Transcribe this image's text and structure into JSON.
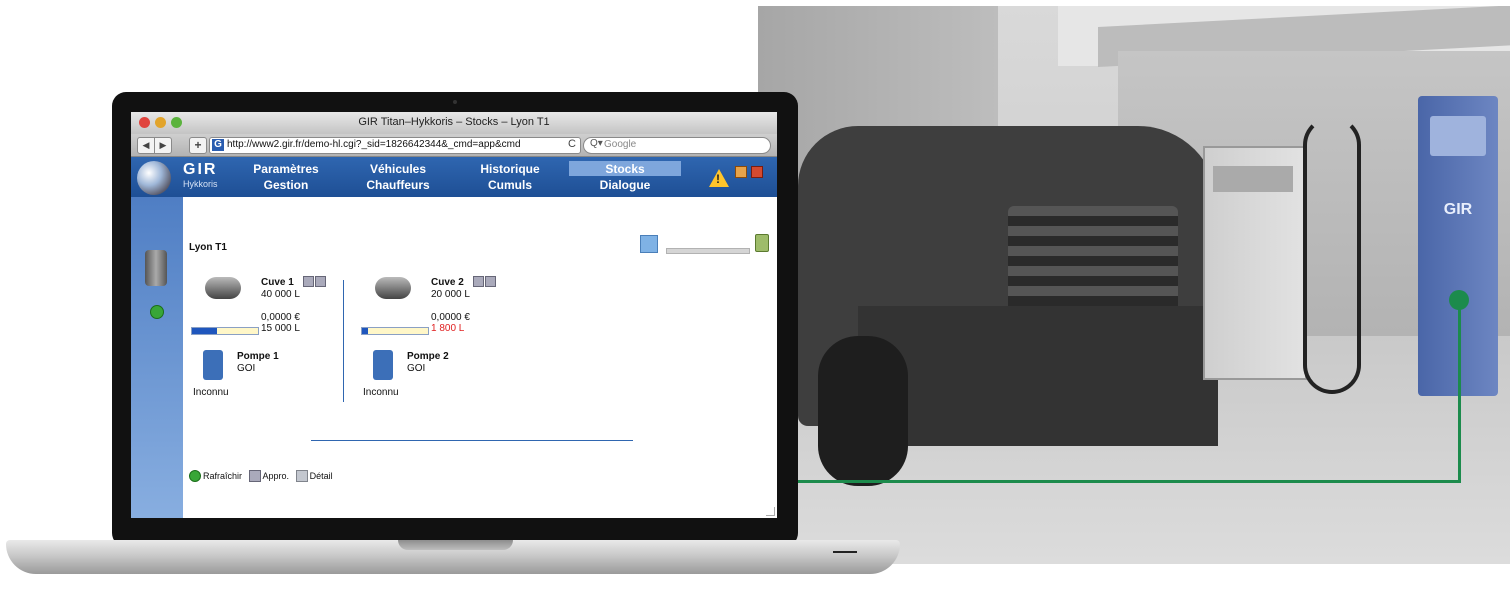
{
  "window": {
    "title": "GIR Titan–Hykkoris – Stocks – Lyon T1"
  },
  "browser": {
    "url": "http://www2.gir.fr/demo-hl.cgi?_sid=1826642344&_cmd=app&cmd",
    "search_placeholder": "Google",
    "back_label": "◀",
    "forward_label": "▶",
    "add_label": "+",
    "reload_label": "C"
  },
  "app": {
    "logo": "GIR",
    "logo_sub": "Hykkoris",
    "menu": [
      {
        "top": "Paramètres",
        "bottom": "Gestion"
      },
      {
        "top": "Véhicules",
        "bottom": "Chauffeurs"
      },
      {
        "top": "Historique",
        "bottom": "Cumuls"
      },
      {
        "top": "Stocks",
        "bottom": "Dialogue"
      }
    ],
    "active_menu": "Stocks",
    "warn_mark": "!"
  },
  "site": {
    "title": "Lyon T1"
  },
  "tanks": [
    {
      "name": "Cuve 1",
      "capacity": "40 000 L",
      "price": "0,0000 €",
      "level": "15 000 L",
      "level_fraction": 0.375,
      "low": false,
      "pump": {
        "name": "Pompe 1",
        "fuel": "GOI",
        "state": "Inconnu"
      }
    },
    {
      "name": "Cuve 2",
      "capacity": "20 000 L",
      "price": "0,0000 €",
      "level": "1 800 L",
      "level_fraction": 0.09,
      "low": true,
      "pump": {
        "name": "Pompe 2",
        "fuel": "GOI",
        "state": "Inconnu"
      }
    }
  ],
  "footer": {
    "refresh": "Rafraîchir",
    "appro": "Appro.",
    "detail": "Détail"
  },
  "photo": {
    "pump_logo": "GIR"
  },
  "colors": {
    "header_blue": "#1e4f95",
    "connector_green": "#1c8b4c",
    "low_level_red": "#e02020"
  }
}
